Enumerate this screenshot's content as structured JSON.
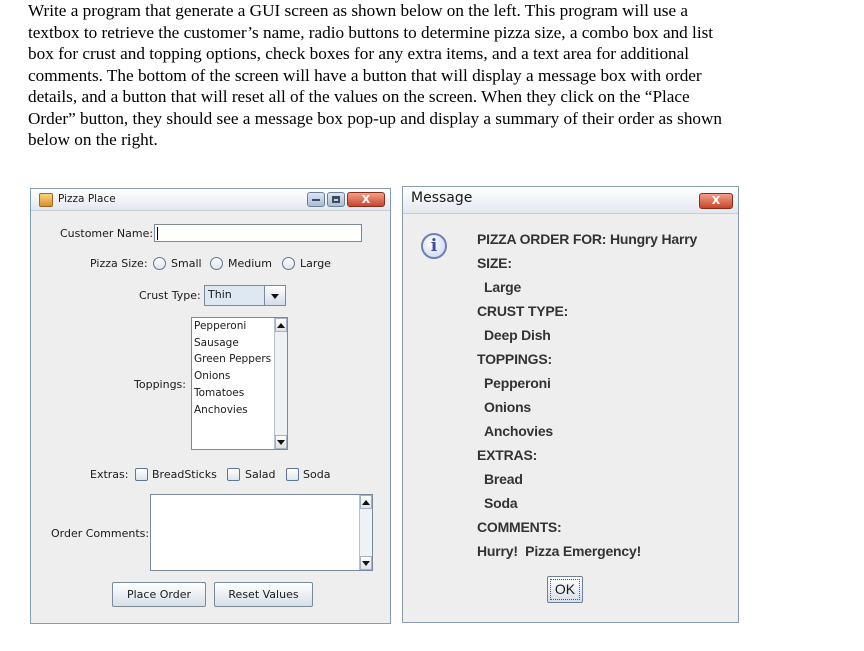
{
  "prompt": {
    "lines": [
      "Write a program that generate a GUI screen as shown below on the left. This program will use a",
      "textbox to retrieve the customer’s name, radio buttons to determine pizza size, a combo box and list",
      "box for crust and topping options, check boxes for any extra items, and a text area for additional",
      "comments. The bottom of the screen will have a button that will display a message box with order",
      "details, and a button that will reset all of the values on the screen. When they click on the “Place",
      "Order” button, they should see a message box pop-up and display a summary of their order as shown",
      "below on the right."
    ]
  },
  "pizza_window": {
    "title": "Pizza Place",
    "customer_name_label": "Customer Name:",
    "customer_name_value": "",
    "pizza_size_label": "Pizza Size:",
    "sizes": [
      "Small",
      "Medium",
      "Large"
    ],
    "crust_label": "Crust Type:",
    "crust_selected": "Thin",
    "toppings_label": "Toppings:",
    "toppings": [
      "Pepperoni",
      "Sausage",
      "Green Peppers",
      "Onions",
      "Tomatoes",
      "Anchovies"
    ],
    "extras_label": "Extras:",
    "extras": [
      "BreadSticks",
      "Salad",
      "Soda"
    ],
    "comments_label": "Order Comments:",
    "place_order": "Place Order",
    "reset_values": "Reset Values"
  },
  "message_window": {
    "title": "Message",
    "close_glyph": "X",
    "icon_glyph": "i",
    "lines": [
      "PIZZA ORDER FOR: Hungry Harry",
      "SIZE:",
      "Large",
      "CRUST TYPE:",
      "Deep Dish",
      "TOPPINGS:",
      "Pepperoni",
      "Onions",
      "Anchovies",
      "EXTRAS:",
      "Bread",
      "Soda",
      "COMMENTS:",
      "Hurry!  Pizza Emergency!"
    ],
    "ok": "OK"
  },
  "colors": {
    "window_bg": "#eeeeee",
    "border": "#7f9db9",
    "close_red": "#c9452b",
    "info_blue": "#3c4fa0"
  }
}
